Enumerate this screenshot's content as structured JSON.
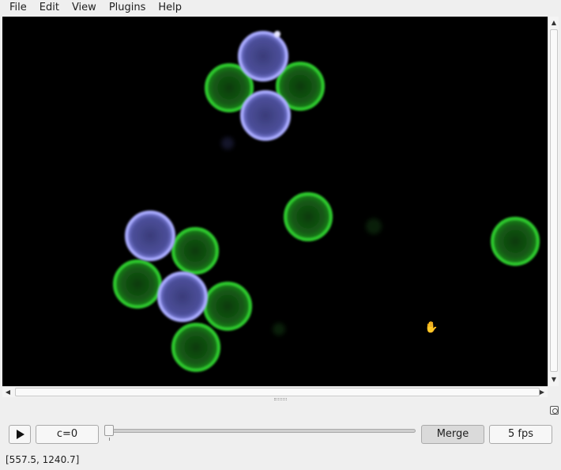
{
  "menubar": {
    "items": [
      "File",
      "Edit",
      "View",
      "Plugins",
      "Help"
    ]
  },
  "viewer": {
    "image_description_icon": "hand-cursor-icon"
  },
  "controls": {
    "channel_label": "c=0",
    "merge_label": "Merge",
    "fps_label": "5 fps",
    "channel_slider_position": 0
  },
  "status": {
    "coordinates": "[557.5, 1240.7]"
  },
  "colors": {
    "green_channel": "#2ecc2e",
    "blue_channel": "#8a8cf0",
    "background": "#000000"
  }
}
